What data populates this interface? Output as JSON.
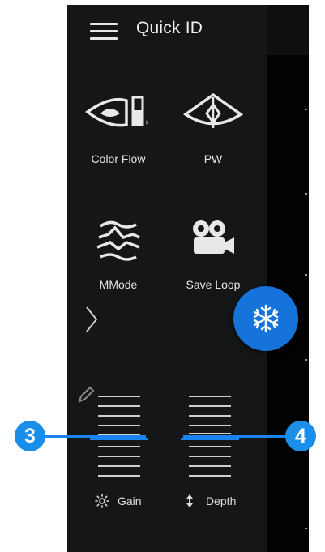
{
  "header": {
    "title": "Quick ID",
    "menu_icon": "hamburger-menu-icon"
  },
  "tools": [
    {
      "label": "Color Flow",
      "icon": "color-flow-icon"
    },
    {
      "label": "PW",
      "icon": "pw-doppler-icon"
    },
    {
      "label": "MMode",
      "icon": "mmode-icon"
    },
    {
      "label": "Save Loop",
      "icon": "save-loop-camera-icon"
    }
  ],
  "freeze_button": {
    "icon": "snowflake-icon",
    "color": "#1673d9"
  },
  "controls": {
    "gain": {
      "label": "Gain",
      "icon": "brightness-icon"
    },
    "depth": {
      "label": "Depth",
      "icon": "up-down-arrow-icon"
    }
  },
  "callouts": [
    {
      "number": "3"
    },
    {
      "number": "4"
    }
  ],
  "colors": {
    "panel": "#151617",
    "accent": "#1b83f0",
    "text": "#e6e6e6"
  }
}
